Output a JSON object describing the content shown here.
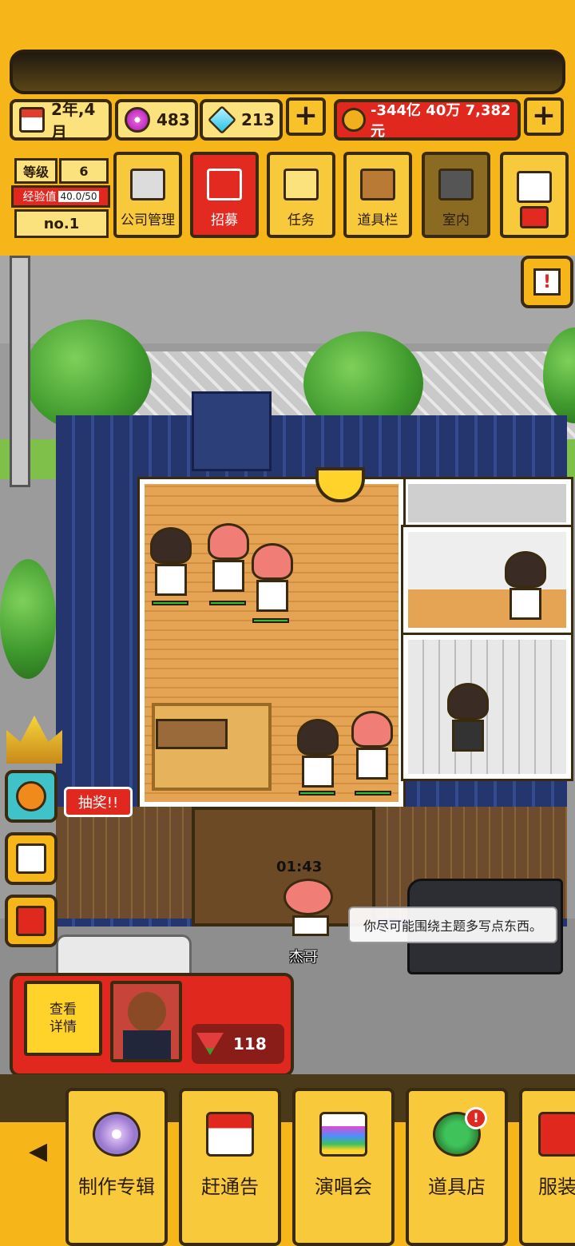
{
  "resources": {
    "date": "2年,4月",
    "disc_count": "483",
    "gem_count": "213",
    "money": "-344亿 40万 7,382元",
    "plus_symbol": "+"
  },
  "level": {
    "level_label": "等级",
    "level_value": "6",
    "exp_label": "经验值",
    "exp_value": "40.0/50",
    "rank": "no.1"
  },
  "menu": [
    {
      "label": "公司管理",
      "icon": "building-icon"
    },
    {
      "label": "招募",
      "icon": "megaphone-icon"
    },
    {
      "label": "任务",
      "icon": "scroll-icon"
    },
    {
      "label": "道具栏",
      "icon": "chest-icon"
    },
    {
      "label": "室内",
      "icon": "paint-roller-icon"
    },
    {
      "label": "",
      "icon": "mail-icon"
    }
  ],
  "notice_button": {
    "symbol": "!"
  },
  "side": {
    "lottery_label": "抽奖!!"
  },
  "npc": {
    "timer": "01:43",
    "name": "杰哥",
    "speech": "你尽可能围绕主题多写点东西。"
  },
  "info_panel": {
    "detail_line1": "查看",
    "detail_line2": "详情",
    "watermelon_count": "118"
  },
  "bottom_nav": [
    {
      "label": "制作专辑",
      "icon": "cd-icon"
    },
    {
      "label": "赶通告",
      "icon": "calendar-icon"
    },
    {
      "label": "演唱会",
      "icon": "rainbow-stage-icon"
    },
    {
      "label": "道具店",
      "icon": "clover-icon",
      "badge": "!"
    },
    {
      "label": "服装",
      "icon": "shirt-icon"
    }
  ],
  "colors": {
    "accent_yellow": "#f6b619",
    "alert_red": "#e0281f",
    "outline": "#3a2b10"
  }
}
